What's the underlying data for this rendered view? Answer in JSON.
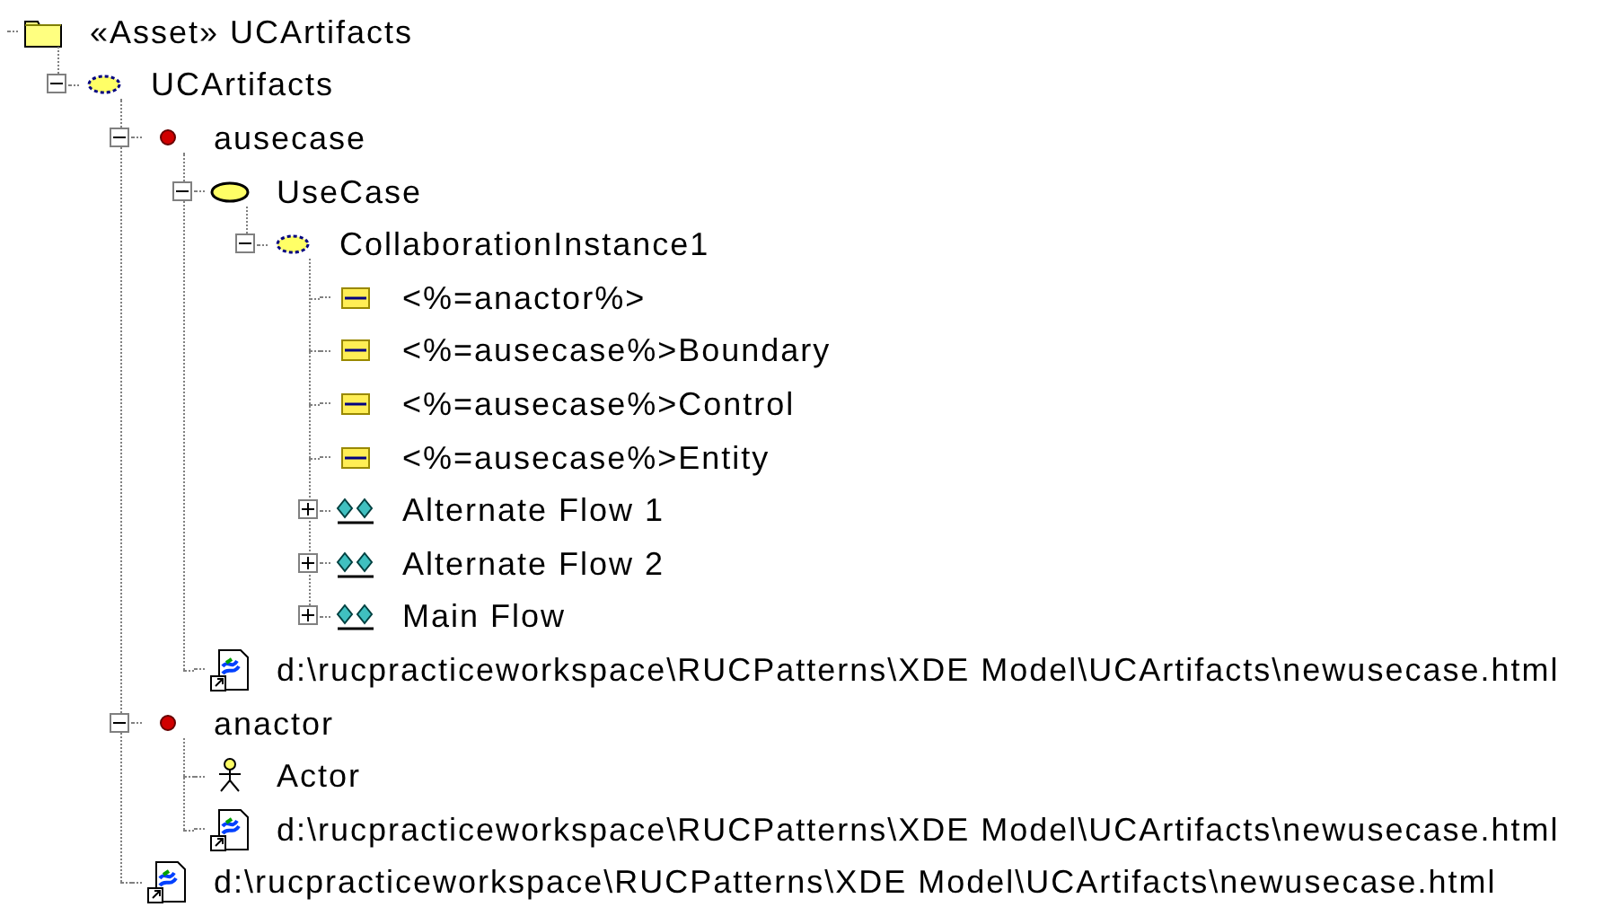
{
  "tree": {
    "kind": "folder",
    "label": "«Asset» UCArtifacts",
    "children": [
      {
        "kind": "collaboration",
        "label": "UCArtifacts",
        "expanded": true,
        "children": [
          {
            "kind": "instance",
            "label": "ausecase",
            "expanded": true,
            "children": [
              {
                "kind": "usecase",
                "label": "UseCase",
                "expanded": true,
                "children": [
                  {
                    "kind": "collaboration",
                    "label": "CollaborationInstance1",
                    "expanded": true,
                    "children": [
                      {
                        "kind": "class",
                        "label": "<%=anactor%>"
                      },
                      {
                        "kind": "class",
                        "label": "<%=ausecase%>Boundary"
                      },
                      {
                        "kind": "class",
                        "label": "<%=ausecase%>Control"
                      },
                      {
                        "kind": "class",
                        "label": "<%=ausecase%>Entity"
                      },
                      {
                        "kind": "flow",
                        "label": "Alternate Flow 1",
                        "expanded": false
                      },
                      {
                        "kind": "flow",
                        "label": "Alternate Flow 2",
                        "expanded": false
                      },
                      {
                        "kind": "flow",
                        "label": "Main Flow",
                        "expanded": false
                      }
                    ]
                  }
                ]
              },
              {
                "kind": "html",
                "label": "d:\\rucpracticeworkspace\\RUCPatterns\\XDE Model\\UCArtifacts\\newusecase.html"
              }
            ]
          },
          {
            "kind": "instance",
            "label": "anactor",
            "expanded": true,
            "children": [
              {
                "kind": "actor",
                "label": "Actor"
              },
              {
                "kind": "html",
                "label": "d:\\rucpracticeworkspace\\RUCPatterns\\XDE Model\\UCArtifacts\\newusecase.html"
              }
            ]
          },
          {
            "kind": "html",
            "label": "d:\\rucpracticeworkspace\\RUCPatterns\\XDE Model\\UCArtifacts\\newusecase.html"
          }
        ]
      }
    ]
  }
}
